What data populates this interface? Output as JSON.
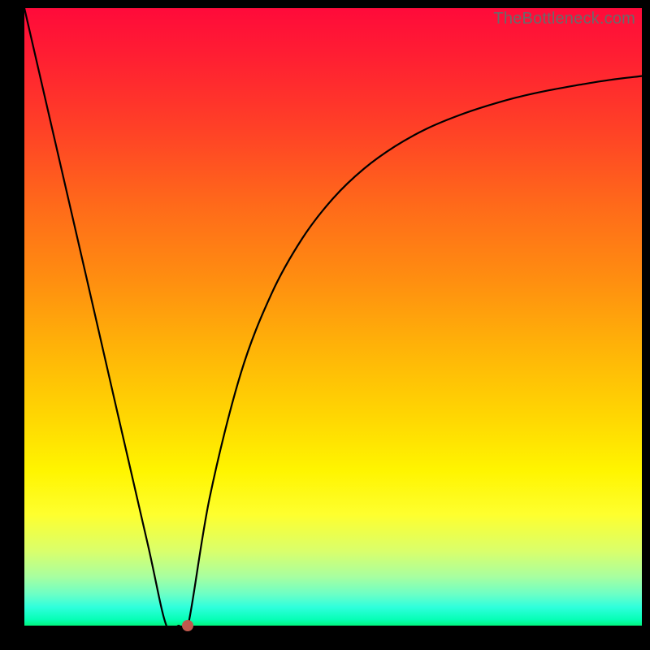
{
  "watermark": "TheBottleneck.com",
  "colors": {
    "frame": "#000000",
    "curve": "#000000",
    "dot": "#c0584d"
  },
  "chart_data": {
    "type": "line",
    "title": "",
    "xlabel": "",
    "ylabel": "",
    "xlim": [
      0,
      100
    ],
    "ylim": [
      0,
      100
    ],
    "grid": false,
    "series": [
      {
        "name": "bottleneck-curve",
        "x": [
          0,
          5,
          10,
          15,
          20,
          23,
          25,
          26.5,
          30,
          35,
          40,
          45,
          50,
          55,
          60,
          65,
          70,
          75,
          80,
          85,
          90,
          95,
          100
        ],
        "values": [
          100,
          78.3,
          56.6,
          34.8,
          13.1,
          0,
          0,
          0,
          20.7,
          40.7,
          53.7,
          62.7,
          69.2,
          74.0,
          77.6,
          80.4,
          82.5,
          84.2,
          85.6,
          86.7,
          87.6,
          88.4,
          89.0
        ]
      }
    ],
    "markers": [
      {
        "name": "optimal-point",
        "x": 26.5,
        "y": 0
      }
    ],
    "background_gradient": {
      "orientation": "vertical",
      "stops": [
        {
          "pos": 0.0,
          "color": "#ff0a3a"
        },
        {
          "pos": 0.5,
          "color": "#ffb308"
        },
        {
          "pos": 0.75,
          "color": "#fff500"
        },
        {
          "pos": 1.0,
          "color": "#02f57f"
        }
      ]
    }
  }
}
